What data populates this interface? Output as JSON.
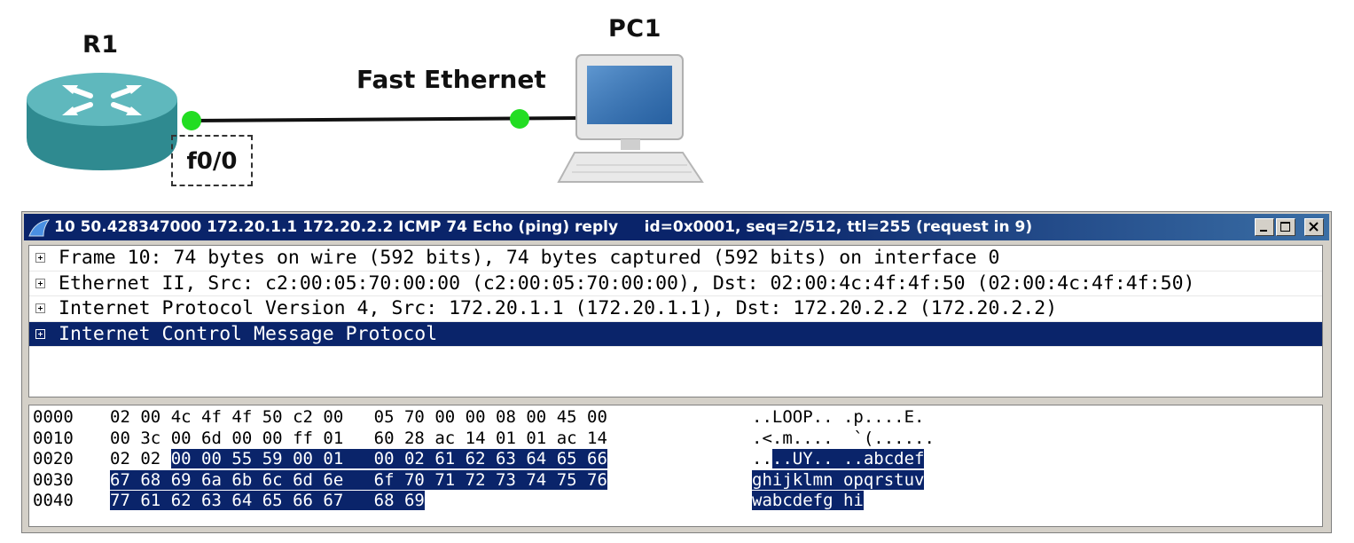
{
  "topology": {
    "router_label": "R1",
    "pc_label": "PC1",
    "link_label": "Fast Ethernet",
    "interface_label": "f0/0"
  },
  "window": {
    "title": "10 50.428347000 172.20.1.1 172.20.2.2 ICMP 74 Echo (ping) reply     id=0x0001, seq=2/512, ttl=255 (request in 9)"
  },
  "tree": [
    {
      "text": "Frame 10: 74 bytes on wire (592 bits), 74 bytes captured (592 bits) on interface 0",
      "selected": false
    },
    {
      "text": "Ethernet II, Src: c2:00:05:70:00:00 (c2:00:05:70:00:00), Dst: 02:00:4c:4f:4f:50 (02:00:4c:4f:4f:50)",
      "selected": false
    },
    {
      "text": "Internet Protocol Version 4, Src: 172.20.1.1 (172.20.1.1), Dst: 172.20.2.2 (172.20.2.2)",
      "selected": false
    },
    {
      "text": "Internet Control Message Protocol",
      "selected": true
    }
  ],
  "hex": [
    {
      "offset": "0000",
      "bytes": [
        "02",
        "00",
        "4c",
        "4f",
        "4f",
        "50",
        "c2",
        "00",
        "05",
        "70",
        "00",
        "00",
        "08",
        "00",
        "45",
        "00"
      ],
      "ascii": "..LOOP.. .p....E.",
      "hl_start": 16
    },
    {
      "offset": "0010",
      "bytes": [
        "00",
        "3c",
        "00",
        "6d",
        "00",
        "00",
        "ff",
        "01",
        "60",
        "28",
        "ac",
        "14",
        "01",
        "01",
        "ac",
        "14"
      ],
      "ascii": ".<.m....  `(......",
      "hl_start": 16
    },
    {
      "offset": "0020",
      "bytes": [
        "02",
        "02",
        "00",
        "00",
        "55",
        "59",
        "00",
        "01",
        "00",
        "02",
        "61",
        "62",
        "63",
        "64",
        "65",
        "66"
      ],
      "ascii": "....UY.. ..abcdef",
      "hl_start": 2
    },
    {
      "offset": "0030",
      "bytes": [
        "67",
        "68",
        "69",
        "6a",
        "6b",
        "6c",
        "6d",
        "6e",
        "6f",
        "70",
        "71",
        "72",
        "73",
        "74",
        "75",
        "76"
      ],
      "ascii": "ghijklmn opqrstuv",
      "hl_start": 0
    },
    {
      "offset": "0040",
      "bytes": [
        "77",
        "61",
        "62",
        "63",
        "64",
        "65",
        "66",
        "67",
        "68",
        "69"
      ],
      "ascii": "wabcdefg hi",
      "hl_start": 0
    }
  ],
  "colors": {
    "selection": "#0a246a",
    "link_endpoint": "#22dd22",
    "router_body": "#3a9aa0"
  }
}
